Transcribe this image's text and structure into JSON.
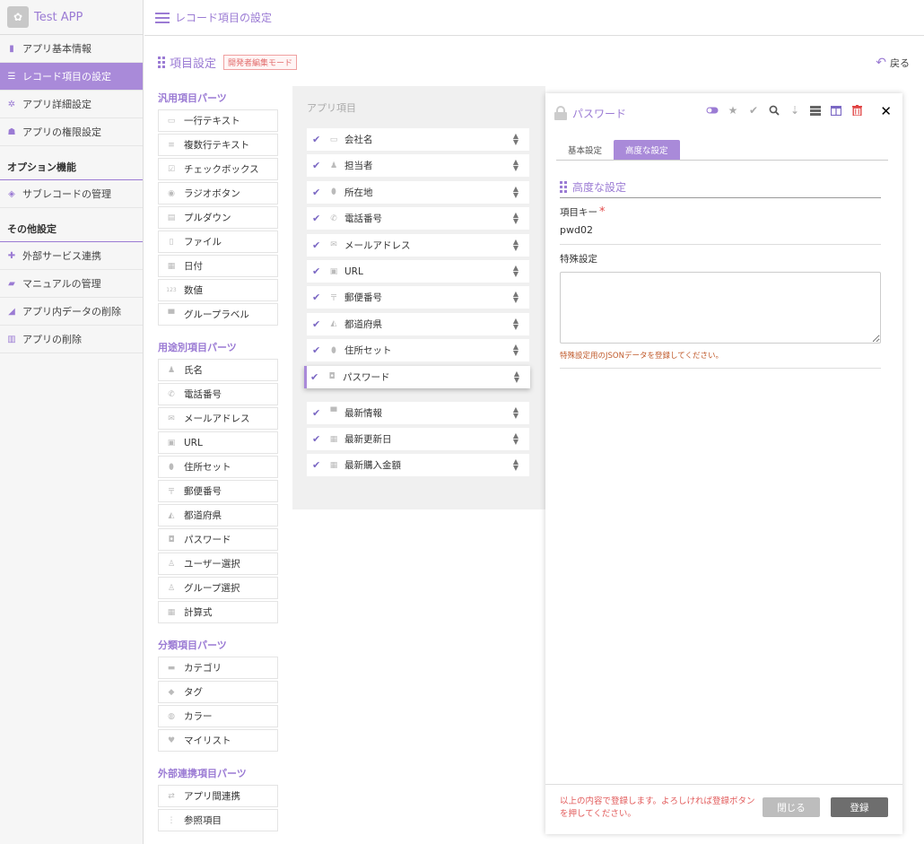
{
  "app": {
    "name": "Test APP"
  },
  "sidebar": {
    "items": [
      {
        "label": "アプリ基本情報",
        "icon": "info-icon",
        "glyph": "▮",
        "active": false
      },
      {
        "label": "レコード項目の設定",
        "icon": "list-icon",
        "glyph": "☰",
        "active": true
      },
      {
        "label": "アプリ詳細設定",
        "icon": "gear-icon",
        "glyph": "✲",
        "active": false
      },
      {
        "label": "アプリの権限設定",
        "icon": "users-icon",
        "glyph": "☗",
        "active": false
      }
    ],
    "option_section": "オプション機能",
    "option_items": [
      {
        "label": "サブレコードの管理",
        "icon": "layers-icon",
        "glyph": "◈"
      }
    ],
    "other_section": "その他設定",
    "other_items": [
      {
        "label": "外部サービス連携",
        "icon": "plugin-icon",
        "glyph": "✚"
      },
      {
        "label": "マニュアルの管理",
        "icon": "book-icon",
        "glyph": "▰"
      },
      {
        "label": "アプリ内データの削除",
        "icon": "eraser-icon",
        "glyph": "◢"
      },
      {
        "label": "アプリの削除",
        "icon": "trash-icon",
        "glyph": "▥"
      }
    ]
  },
  "topbar": {
    "title": "レコード項目の設定"
  },
  "header": {
    "title": "項目設定",
    "badge": "開発者編集モード",
    "back": "戻る"
  },
  "palette": {
    "general_head": "汎用項目パーツ",
    "general": [
      {
        "label": "一行テキスト",
        "icon": "single-line-icon",
        "glyph": "▭"
      },
      {
        "label": "複数行テキスト",
        "icon": "multi-line-icon",
        "glyph": "≡"
      },
      {
        "label": "チェックボックス",
        "icon": "checkbox-icon",
        "glyph": "☑"
      },
      {
        "label": "ラジオボタン",
        "icon": "radio-icon",
        "glyph": "◉"
      },
      {
        "label": "プルダウン",
        "icon": "dropdown-icon",
        "glyph": "▤"
      },
      {
        "label": "ファイル",
        "icon": "file-icon",
        "glyph": "▯"
      },
      {
        "label": "日付",
        "icon": "calendar-icon",
        "glyph": "▦"
      },
      {
        "label": "数値",
        "icon": "number-icon",
        "glyph": "123"
      },
      {
        "label": "グループラベル",
        "icon": "group-label-icon",
        "glyph": "▀"
      }
    ],
    "purpose_head": "用途別項目パーツ",
    "purpose": [
      {
        "label": "氏名",
        "icon": "person-icon",
        "glyph": "♟"
      },
      {
        "label": "電話番号",
        "icon": "phone-icon",
        "glyph": "✆"
      },
      {
        "label": "メールアドレス",
        "icon": "mail-icon",
        "glyph": "✉"
      },
      {
        "label": "URL",
        "icon": "url-icon",
        "glyph": "▣"
      },
      {
        "label": "住所セット",
        "icon": "location-icon",
        "glyph": "⬮"
      },
      {
        "label": "郵便番号",
        "icon": "postal-icon",
        "glyph": "〒"
      },
      {
        "label": "都道府県",
        "icon": "map-icon",
        "glyph": "◭"
      },
      {
        "label": "パスワード",
        "icon": "lock-icon",
        "glyph": "◘"
      },
      {
        "label": "ユーザー選択",
        "icon": "user-select-icon",
        "glyph": "♙"
      },
      {
        "label": "グループ選択",
        "icon": "group-select-icon",
        "glyph": "♙"
      },
      {
        "label": "計算式",
        "icon": "calc-icon",
        "glyph": "▦"
      }
    ],
    "category_head": "分類項目パーツ",
    "category": [
      {
        "label": "カテゴリ",
        "icon": "folder-icon",
        "glyph": "▬"
      },
      {
        "label": "タグ",
        "icon": "tag-icon",
        "glyph": "◆"
      },
      {
        "label": "カラー",
        "icon": "palette-icon",
        "glyph": "◍"
      },
      {
        "label": "マイリスト",
        "icon": "heart-icon",
        "glyph": "♥"
      }
    ],
    "external_head": "外部連携項目パーツ",
    "external": [
      {
        "label": "アプリ間連携",
        "icon": "link-icon",
        "glyph": "⇄"
      },
      {
        "label": "参照項目",
        "icon": "reference-icon",
        "glyph": "⋮"
      }
    ]
  },
  "fields": {
    "title": "アプリ項目",
    "items": [
      {
        "label": "会社名",
        "icon": "single-line-icon",
        "glyph": "▭"
      },
      {
        "label": "担当者",
        "icon": "person-icon",
        "glyph": "♟"
      },
      {
        "label": "所在地",
        "icon": "location-icon",
        "glyph": "⬮"
      },
      {
        "label": "電話番号",
        "icon": "phone-icon",
        "glyph": "✆"
      },
      {
        "label": "メールアドレス",
        "icon": "mail-icon",
        "glyph": "✉"
      },
      {
        "label": "URL",
        "icon": "url-icon",
        "glyph": "▣"
      },
      {
        "label": "郵便番号",
        "icon": "postal-icon",
        "glyph": "〒"
      },
      {
        "label": "都道府県",
        "icon": "map-icon",
        "glyph": "◭"
      },
      {
        "label": "住所セット",
        "icon": "location-icon",
        "glyph": "⬮"
      },
      {
        "label": "パスワード",
        "icon": "lock-icon",
        "glyph": "◘",
        "selected": true
      },
      {
        "label": "最新情報",
        "icon": "group-label-icon",
        "glyph": "▀"
      },
      {
        "label": "最新更新日",
        "icon": "calc-icon",
        "glyph": "▦"
      },
      {
        "label": "最新購入金額",
        "icon": "calc-icon",
        "glyph": "▦"
      }
    ]
  },
  "detail": {
    "name": "パスワード",
    "tabs": [
      {
        "label": "基本設定",
        "active": false
      },
      {
        "label": "高度な設定",
        "active": true
      }
    ],
    "section_title": "高度な設定",
    "key_label": "項目キー",
    "required_mark": "*",
    "key_value": "pwd02",
    "special_label": "特殊設定",
    "special_value": "",
    "hint": "特殊設定用のJSONデータを登録してください。",
    "footer_msg": "以上の内容で登録します。よろしければ登録ボタンを押してください。",
    "close_btn": "閉じる",
    "save_btn": "登録"
  },
  "colors": {
    "accent": "#9b7bd4",
    "active_nav": "#a98ad9",
    "warning": "#e25b5b",
    "trash": "#e04040"
  }
}
